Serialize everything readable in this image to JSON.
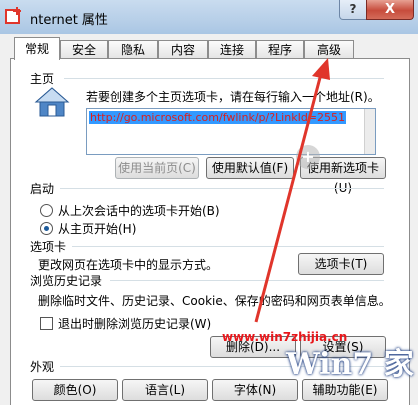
{
  "window": {
    "title": "nternet 属性",
    "help_glyph": "?",
    "close_glyph": "X"
  },
  "tabs": [
    {
      "label": "常规",
      "active": true
    },
    {
      "label": "安全"
    },
    {
      "label": "隐私"
    },
    {
      "label": "内容"
    },
    {
      "label": "连接"
    },
    {
      "label": "程序"
    },
    {
      "label": "高级"
    }
  ],
  "homepage": {
    "group_label": "主页",
    "description": "若要创建多个主页选项卡，请在每行输入一个地址(R)。",
    "url": "http://go.microsoft.com/fwlink/p/?LinkId=2551",
    "btn_current": "使用当前页(C)",
    "btn_default": "使用默认值(F)",
    "btn_new_tab": "使用新选项卡(U)"
  },
  "startup": {
    "group_label": "启动",
    "option_last": "从上次会话中的选项卡开始(B)",
    "option_home": "从主页开始(H)",
    "selected": "option_home"
  },
  "tabs_section": {
    "group_label": "选项卡",
    "description": "更改网页在选项卡中的显示方式。",
    "button": "选项卡(T)"
  },
  "history": {
    "group_label": "浏览历史记录",
    "description": "删除临时文件、历史记录、Cookie、保存的密码和网页表单信息。",
    "checkbox_label": "退出时删除浏览历史记录(W)",
    "checkbox_checked": false,
    "btn_delete": "删除(D)...",
    "btn_settings": "设置(S)"
  },
  "appearance": {
    "group_label": "外观",
    "btn_colors": "颜色(O)",
    "btn_languages": "语言(L)",
    "btn_fonts": "字体(N)",
    "btn_accessibility": "辅助功能(E)"
  },
  "watermark": {
    "site": "www.win7zhijia.cn",
    "logo": "Win7 家"
  },
  "colors": {
    "arrow": "#e0352b",
    "selection": "#3399ff"
  }
}
